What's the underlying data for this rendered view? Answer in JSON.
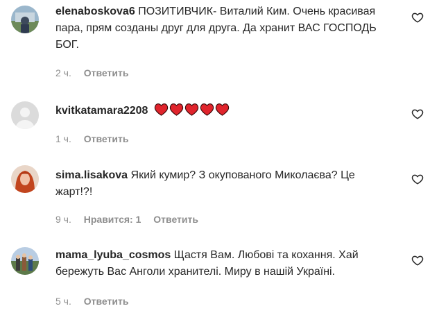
{
  "comments": [
    {
      "username": "elenaboskova6",
      "text": "ПОЗИТИВЧИК- Виталий Ким. Очень красивая пара, прям созданы друг для друга. Да хранит ВАС ГОСПОДЬ БОГ.",
      "time": "2 ч.",
      "reply_label": "Ответить",
      "avatar_icon": "user-photo-avatar"
    },
    {
      "username": "kvitkatamara2208",
      "text": "",
      "emoji_icons": [
        "red-heart-icon",
        "red-heart-icon",
        "red-heart-icon",
        "red-heart-icon",
        "red-heart-icon"
      ],
      "time": "1 ч.",
      "reply_label": "Ответить",
      "avatar_icon": "default-avatar"
    },
    {
      "username": "sima.lisakova",
      "text": "Який кумир? З окупованого Миколаєва? Це жарт!?!",
      "time": "9 ч.",
      "likes_label": "Нравится: 1",
      "reply_label": "Ответить",
      "avatar_icon": "user-photo-avatar"
    },
    {
      "username": "mama_lyuba_cosmos",
      "text": "Щастя Вам. Любові та кохання. Хай бережуть Вас Анголи хранителі. Миру в нашій Україні.",
      "time": "5 ч.",
      "reply_label": "Ответить",
      "avatar_icon": "user-photo-avatar"
    }
  ],
  "colors": {
    "text": "#262626",
    "secondary": "#8e8e8e",
    "heart": "#e0242c"
  }
}
